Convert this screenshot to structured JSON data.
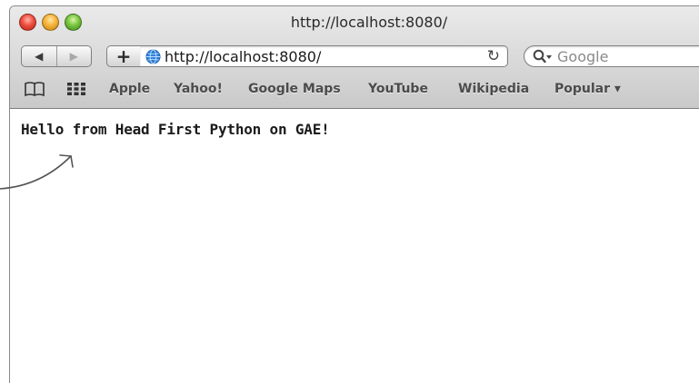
{
  "window": {
    "title": "http://localhost:8080/"
  },
  "toolbar": {
    "back_label": "◀",
    "forward_label": "▶",
    "add_label": "+",
    "url": "http://localhost:8080/",
    "reload_label": "↻",
    "search_placeholder": "Google"
  },
  "bookmarks": {
    "items": [
      {
        "label": "Apple"
      },
      {
        "label": "Yahoo!"
      },
      {
        "label": "Google Maps"
      },
      {
        "label": "YouTube"
      },
      {
        "label": "Wikipedia"
      },
      {
        "label": "Popular ▾"
      }
    ]
  },
  "page": {
    "text": "Hello from Head First Python on GAE!"
  },
  "colors": {
    "chrome_top": "#eaeaea",
    "chrome_bottom": "#c9c9c9",
    "close": "#ee4e3f",
    "minimize": "#f6b33a",
    "zoom": "#79c43f",
    "globe": "#2f7fd6"
  }
}
